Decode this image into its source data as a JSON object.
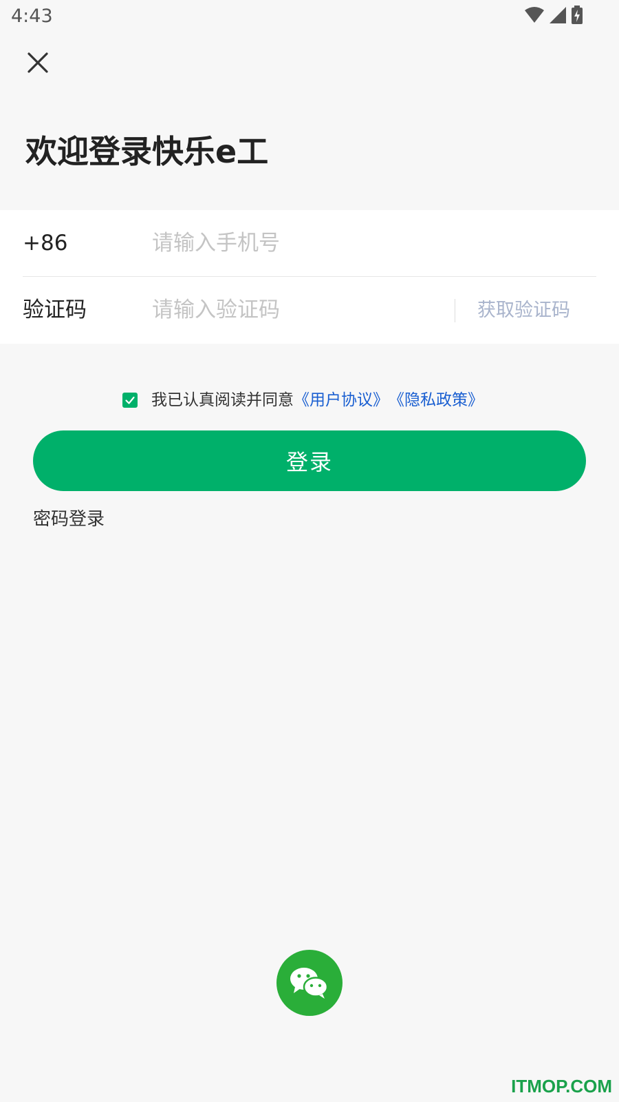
{
  "status_bar": {
    "time": "4:43",
    "icons": [
      "wifi-icon",
      "cell-signal-icon",
      "battery-charging-icon"
    ]
  },
  "header": {
    "close_icon": "close-icon",
    "title": "欢迎登录快乐e工"
  },
  "form": {
    "phone": {
      "label": "+86",
      "placeholder": "请输入手机号",
      "value": ""
    },
    "code": {
      "label": "验证码",
      "placeholder": "请输入验证码",
      "value": "",
      "get_code_label": "获取验证码"
    }
  },
  "agreement": {
    "checked": true,
    "text": "我已认真阅读并同意",
    "user_agreement_link": "《用户协议》",
    "privacy_link": "《隐私政策》"
  },
  "login_button": "登录",
  "password_login": "密码登录",
  "wechat_login_icon": "wechat-icon",
  "watermark": "ITMOP.COM",
  "colors": {
    "primary": "#00b06a",
    "wechat": "#2aae39",
    "link": "#1a5fd1",
    "get_code": "#a9b4cc",
    "background": "#f7f7f7"
  }
}
